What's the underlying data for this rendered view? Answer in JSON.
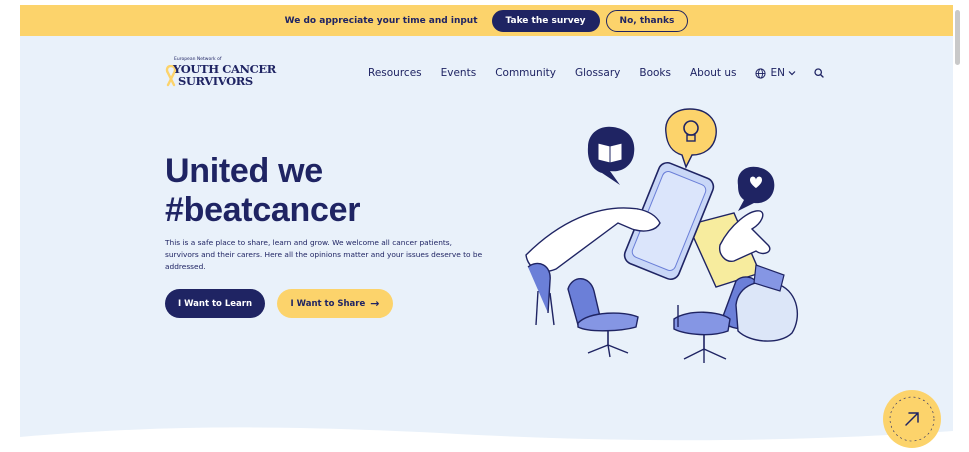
{
  "survey_banner": {
    "message": "We do appreciate your time and input",
    "take_survey_label": "Take the survey",
    "decline_label": "No, thanks"
  },
  "logo": {
    "small_text": "European Network of",
    "line1": "YOUTH CANCER",
    "line2": "SURVIVORS"
  },
  "nav": {
    "items": [
      "Resources",
      "Events",
      "Community",
      "Glossary",
      "Books",
      "About us"
    ],
    "language": "EN"
  },
  "hero": {
    "title_line1": "United we",
    "title_line2": "#beatcancer",
    "description": "This is a safe place to share, learn and grow. We welcome all cancer patients, survivors and their carers. Here all the opinions matter and your issues deserve to be addressed.",
    "learn_button": "I Want to Learn",
    "share_button": "I Want to Share"
  },
  "colors": {
    "navy": "#1f2463",
    "yellow": "#fcd36b",
    "background": "#e9f1fa",
    "chair_blue": "#6b7fd8"
  }
}
